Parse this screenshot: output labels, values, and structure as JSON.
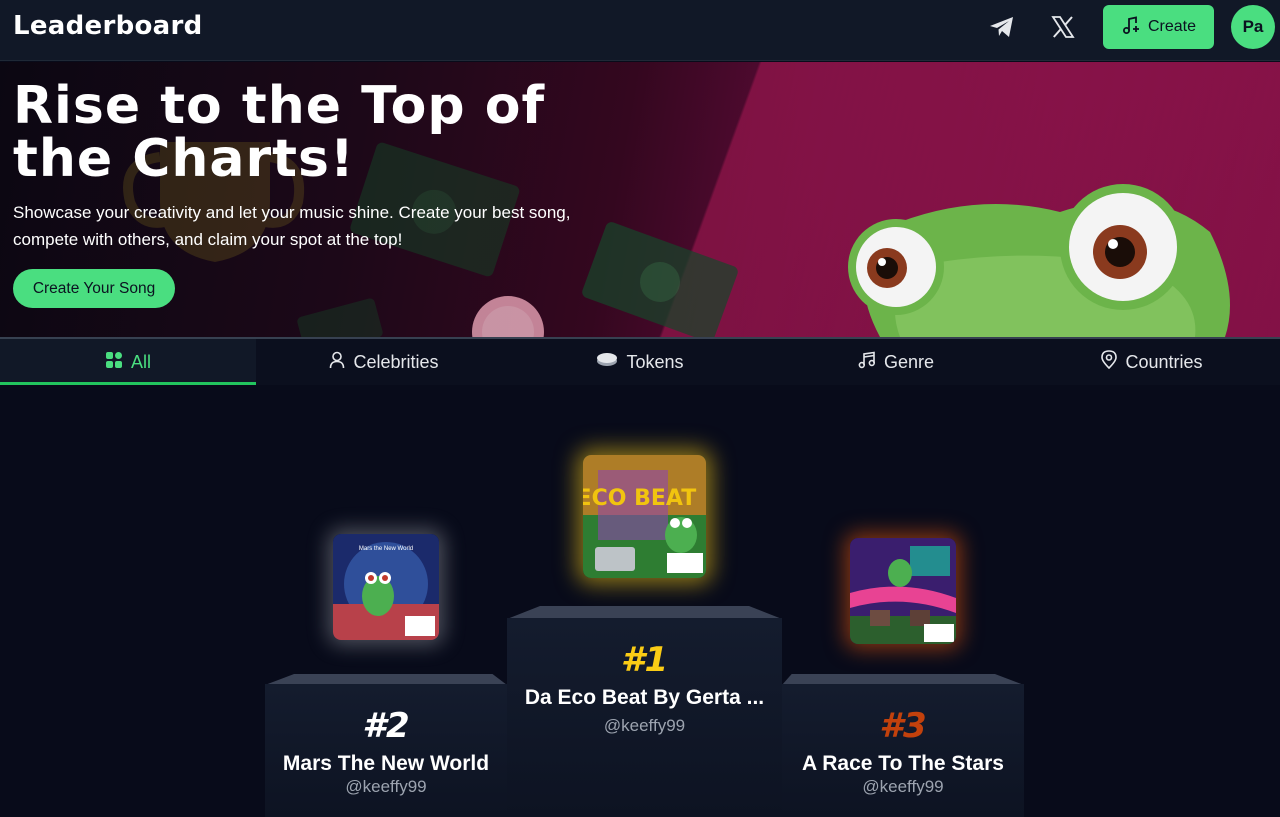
{
  "header": {
    "brand": "Leaderboard",
    "icons": [
      "telegram-icon",
      "x-logo-icon"
    ],
    "create_label": "Create",
    "avatar_initials": "Pa"
  },
  "hero": {
    "title": "Rise to the Top of the Charts!",
    "subtitle": "Showcase your creativity and let your music shine. Create your best song, compete with others, and claim your spot at the top!",
    "cta_label": "Create Your Song"
  },
  "tabs": [
    {
      "label": "All",
      "icon": "grid-icon",
      "active": true
    },
    {
      "label": "Celebrities",
      "icon": "user-icon",
      "active": false
    },
    {
      "label": "Tokens",
      "icon": "coins-icon",
      "active": false
    },
    {
      "label": "Genre",
      "icon": "music-note-icon",
      "active": false
    },
    {
      "label": "Countries",
      "icon": "location-pin-icon",
      "active": false
    }
  ],
  "podium": {
    "first": {
      "rank": "#1",
      "title": "Da Eco Beat By Gerta ...",
      "artist": "@keeffy99",
      "cover_text": "BECO BEAT"
    },
    "second": {
      "rank": "#2",
      "title": "Mars The New World",
      "artist": "@keeffy99",
      "cover_text": "Mars the New World"
    },
    "third": {
      "rank": "#3",
      "title": "A Race To The Stars",
      "artist": "@keeffy99"
    }
  },
  "colors": {
    "accent": "#4ade80",
    "gold": "#facc15",
    "bronze": "#c2410c",
    "background": "#080b1a"
  }
}
